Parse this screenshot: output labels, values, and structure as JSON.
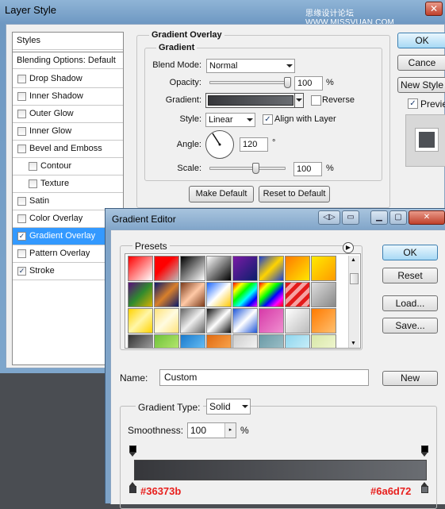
{
  "layer_style": {
    "title": "Layer Style",
    "watermark": "思缘设计论坛 WWW.MISSVUAN.COM",
    "styles_header": "Styles",
    "blending_options": "Blending Options: Default",
    "items": [
      {
        "label": "Drop Shadow",
        "checked": false,
        "indent": false
      },
      {
        "label": "Inner Shadow",
        "checked": false,
        "indent": false
      },
      {
        "label": "Outer Glow",
        "checked": false,
        "indent": false
      },
      {
        "label": "Inner Glow",
        "checked": false,
        "indent": false
      },
      {
        "label": "Bevel and Emboss",
        "checked": false,
        "indent": false
      },
      {
        "label": "Contour",
        "checked": false,
        "indent": true
      },
      {
        "label": "Texture",
        "checked": false,
        "indent": true
      },
      {
        "label": "Satin",
        "checked": false,
        "indent": false
      },
      {
        "label": "Color Overlay",
        "checked": false,
        "indent": false
      },
      {
        "label": "Gradient Overlay",
        "checked": true,
        "indent": false,
        "selected": true
      },
      {
        "label": "Pattern Overlay",
        "checked": false,
        "indent": false
      },
      {
        "label": "Stroke",
        "checked": true,
        "indent": false
      }
    ],
    "panel": {
      "section_title": "Gradient Overlay",
      "group_title": "Gradient",
      "blend_mode_label": "Blend Mode:",
      "blend_mode_value": "Normal",
      "opacity_label": "Opacity:",
      "opacity_value": "100",
      "opacity_unit": "%",
      "opacity_fraction": 1.0,
      "gradient_label": "Gradient:",
      "reverse_label": "Reverse",
      "reverse_checked": false,
      "style_label": "Style:",
      "style_value": "Linear",
      "align_label": "Align with Layer",
      "align_checked": true,
      "angle_label": "Angle:",
      "angle_value": "120",
      "angle_unit": "°",
      "scale_label": "Scale:",
      "scale_value": "100",
      "scale_unit": "%",
      "scale_fraction": 0.6,
      "make_default": "Make Default",
      "reset_default": "Reset to Default"
    },
    "buttons": {
      "ok": "OK",
      "cancel": "Cance",
      "new_style": "New Style",
      "preview": "Previe"
    }
  },
  "gradient_editor": {
    "title": "Gradient Editor",
    "presets_label": "Presets",
    "ok": "OK",
    "reset": "Reset",
    "load": "Load...",
    "save": "Save...",
    "name_label": "Name:",
    "name_value": "Custom",
    "new_button": "New",
    "gradient_type_label": "Gradient Type:",
    "gradient_type_value": "Solid",
    "smoothness_label": "Smoothness:",
    "smoothness_value": "100",
    "smoothness_unit": "%",
    "color_left": "#36373b",
    "color_right": "#6a6d72",
    "color_left_label": "#36373b",
    "color_right_label": "#6a6d72"
  },
  "colors": {
    "accent": "#3399ff",
    "annotation_red": "#e8201e"
  }
}
